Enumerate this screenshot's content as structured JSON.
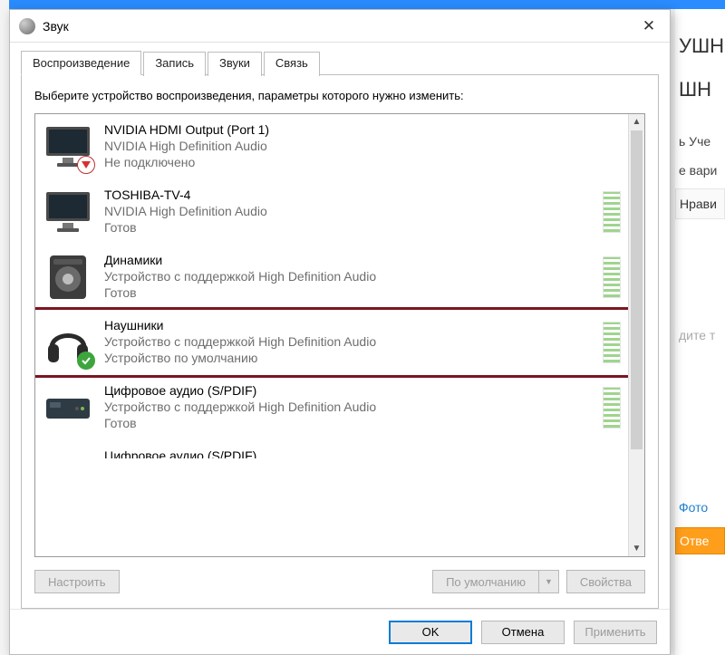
{
  "dialog": {
    "title": "Звук",
    "close": "✕"
  },
  "tabs": {
    "playback": "Воспроизведение",
    "recording": "Запись",
    "sounds": "Звуки",
    "comms": "Связь"
  },
  "instruction": "Выберите устройство воспроизведения, параметры которого нужно изменить:",
  "devices": [
    {
      "name": "NVIDIA HDMI Output (Port 1)",
      "sub": "NVIDIA High Definition Audio",
      "status": "Не подключено",
      "icon": "monitor",
      "badge": "down",
      "meter": false
    },
    {
      "name": "TOSHIBA-TV-4",
      "sub": "NVIDIA High Definition Audio",
      "status": "Готов",
      "icon": "monitor",
      "badge": null,
      "meter": true
    },
    {
      "name": "Динамики",
      "sub": "Устройство с поддержкой High Definition Audio",
      "status": "Готов",
      "icon": "speaker",
      "badge": null,
      "meter": true
    },
    {
      "name": "Наушники",
      "sub": "Устройство с поддержкой High Definition Audio",
      "status": "Устройство по умолчанию",
      "icon": "headphones",
      "badge": "check",
      "meter": true,
      "highlight": true
    },
    {
      "name": "Цифровое аудио (S/PDIF)",
      "sub": "Устройство с поддержкой High Definition Audio",
      "status": "Готов",
      "icon": "optical",
      "badge": null,
      "meter": true
    }
  ],
  "partial_device_name": "Цифровое аудио (S/PDIF)",
  "toolbar": {
    "configure": "Настроить",
    "default": "По умолчанию",
    "properties": "Свойства"
  },
  "footer": {
    "ok": "OK",
    "cancel": "Отмена",
    "apply": "Применить"
  },
  "bg": {
    "frag1": "УШН",
    "frag2": "ШН",
    "frag3": "ь Уче",
    "frag4": "е вари",
    "frag5": "Нрави",
    "frag6": "дите т",
    "frag7": "Фото",
    "frag8": "Отве"
  }
}
